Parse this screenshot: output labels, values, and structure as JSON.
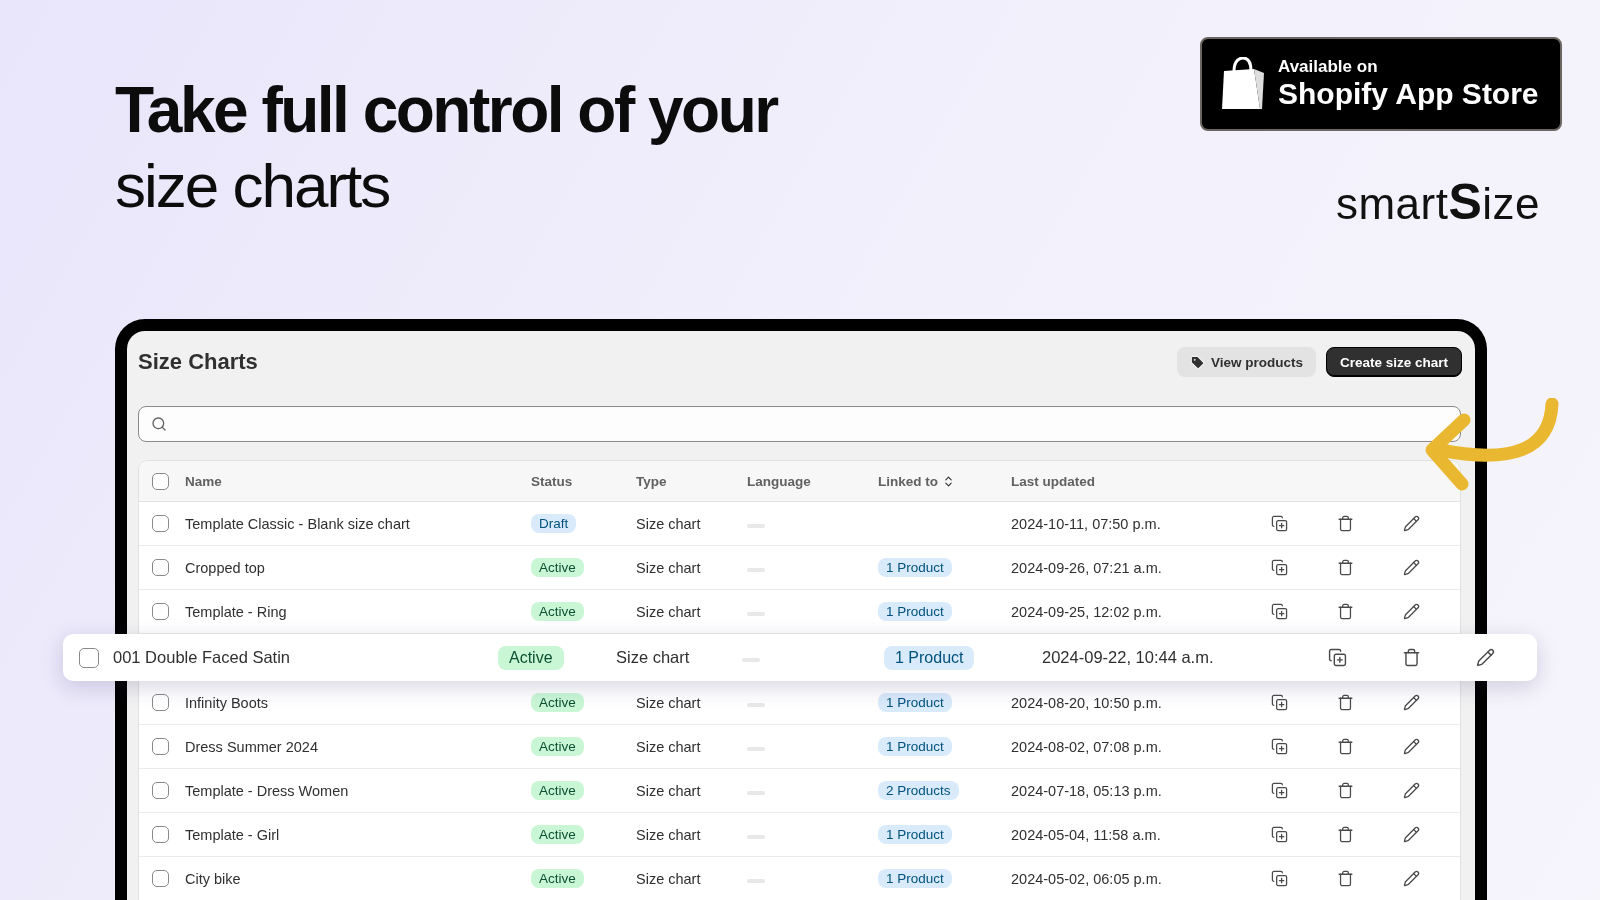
{
  "hero": {
    "headline": "Take full control of your",
    "subheadline": "size charts"
  },
  "store_badge": {
    "line_1": "Available on",
    "line_2": "Shopify App Store"
  },
  "brand_logo": "smart**S**ize",
  "app": {
    "title": "Size Charts",
    "buttons": [
      {
        "label": "View products",
        "kind": "secondary"
      },
      {
        "label": "Create size chart",
        "kind": "primary"
      }
    ],
    "table": {
      "select_all_checked": false,
      "columns": [
        {
          "label": "Name",
          "sortable": false
        },
        {
          "label": "Status",
          "sortable": false
        },
        {
          "label": "Type",
          "sortable": false
        },
        {
          "label": "Language",
          "sortable": false
        },
        {
          "label": "Linked to",
          "sortable": true
        },
        {
          "label": "Last updated",
          "sortable": false
        }
      ],
      "rows": [
        {
          "name": "Template Classic - Blank size chart",
          "status": "Draft",
          "kind": "draft",
          "type": "Size chart",
          "updated": "2024-10-11, 07:50 p.m.",
          "checked": false,
          "lifted": false
        },
        {
          "name": "Cropped top",
          "status": "Active",
          "kind": "active",
          "type": "Size chart",
          "linked": "1 Product",
          "updated": "2024-09-26, 07:21 a.m.",
          "checked": false,
          "lifted": false
        },
        {
          "name": "Template - Ring",
          "status": "Active",
          "kind": "active",
          "type": "Size chart",
          "linked": "1 Product",
          "updated": "2024-09-25, 12:02 p.m.",
          "checked": false,
          "lifted": false
        },
        {
          "name": "001 Double Faced Satin",
          "status": "Active",
          "kind": "active",
          "type": "Size chart",
          "linked": "1 Product",
          "updated": "2024-09-22, 10:44 a.m.",
          "checked": false,
          "lifted": true
        },
        {
          "name": "Infinity Boots",
          "status": "Active",
          "kind": "active",
          "type": "Size chart",
          "linked": "1 Product",
          "updated": "2024-08-20, 10:50 p.m.",
          "checked": false,
          "lifted": false
        },
        {
          "name": "Dress Summer 2024",
          "status": "Active",
          "kind": "active",
          "type": "Size chart",
          "linked": "1 Product",
          "updated": "2024-08-02, 07:08 p.m.",
          "checked": false,
          "lifted": false
        },
        {
          "name": "Template - Dress Women",
          "status": "Active",
          "kind": "active",
          "type": "Size chart",
          "linked": "2 Products",
          "updated": "2024-07-18, 05:13 p.m.",
          "checked": false,
          "lifted": false
        },
        {
          "name": "Template - Girl",
          "status": "Active",
          "kind": "active",
          "type": "Size chart",
          "linked": "1 Product",
          "updated": "2024-05-04, 11:58 a.m.",
          "checked": false,
          "lifted": false
        },
        {
          "name": "City bike",
          "status": "Active",
          "kind": "active",
          "type": "Size chart",
          "linked": "1 Product",
          "updated": "2024-05-02, 06:05 p.m.",
          "checked": false,
          "lifted": false
        }
      ]
    }
  }
}
